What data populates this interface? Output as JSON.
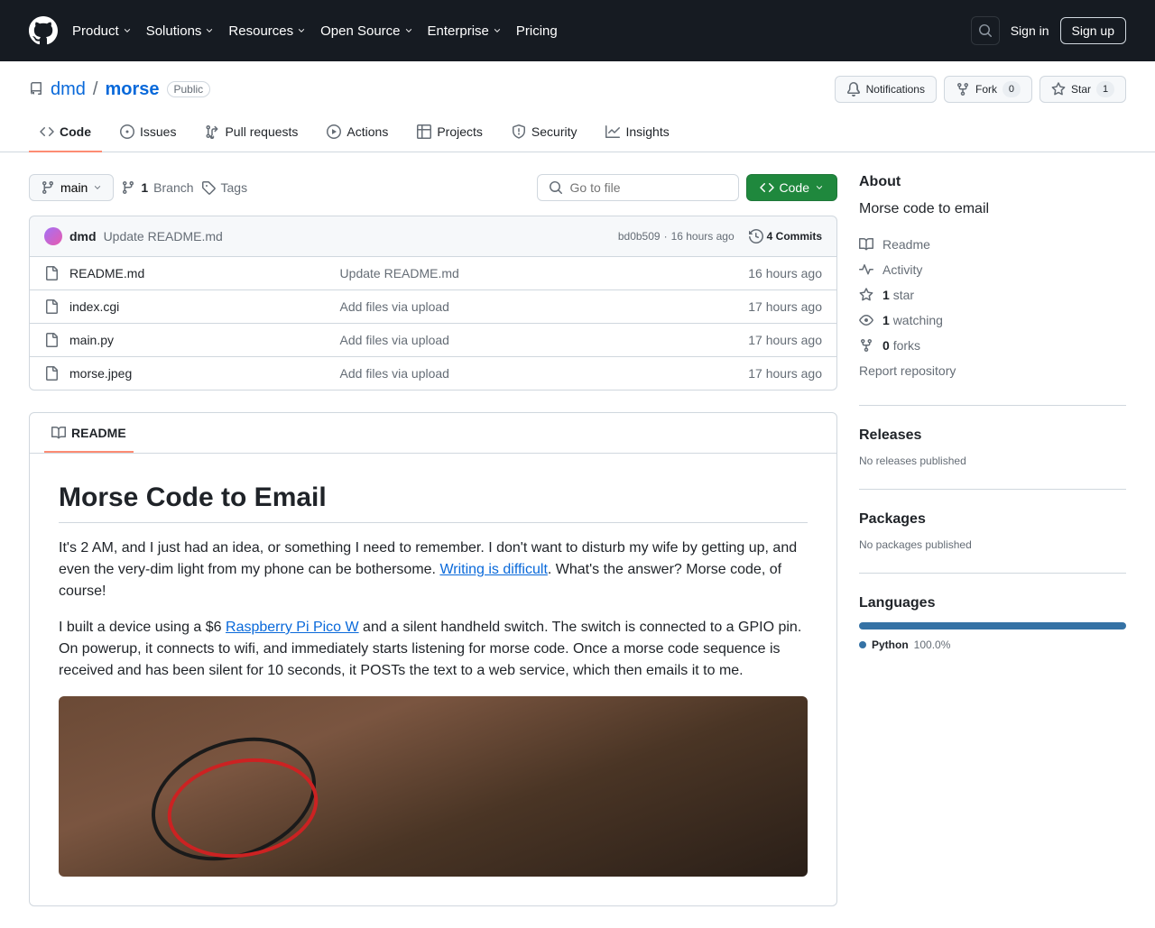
{
  "header": {
    "nav": [
      "Product",
      "Solutions",
      "Resources",
      "Open Source",
      "Enterprise",
      "Pricing"
    ],
    "signin": "Sign in",
    "signup": "Sign up"
  },
  "repo": {
    "owner": "dmd",
    "name": "morse",
    "visibility": "Public",
    "actions": {
      "notifications": "Notifications",
      "fork": "Fork",
      "fork_count": "0",
      "star": "Star",
      "star_count": "1"
    }
  },
  "tabs": [
    {
      "label": "Code",
      "icon": "code",
      "active": true
    },
    {
      "label": "Issues",
      "icon": "issues"
    },
    {
      "label": "Pull requests",
      "icon": "pr"
    },
    {
      "label": "Actions",
      "icon": "play"
    },
    {
      "label": "Projects",
      "icon": "table"
    },
    {
      "label": "Security",
      "icon": "shield"
    },
    {
      "label": "Insights",
      "icon": "graph"
    }
  ],
  "branch": {
    "name": "main",
    "branches_count": "1",
    "branches_label": "Branch",
    "tags_label": "Tags"
  },
  "gotofile_placeholder": "Go to file",
  "code_btn": "Code",
  "commit": {
    "author": "dmd",
    "message": "Update README.md",
    "sha": "bd0b509",
    "time": "16 hours ago",
    "count_label": "4 Commits"
  },
  "files": [
    {
      "name": "README.md",
      "msg": "Update README.md",
      "time": "16 hours ago"
    },
    {
      "name": "index.cgi",
      "msg": "Add files via upload",
      "time": "17 hours ago"
    },
    {
      "name": "main.py",
      "msg": "Add files via upload",
      "time": "17 hours ago"
    },
    {
      "name": "morse.jpeg",
      "msg": "Add files via upload",
      "time": "17 hours ago"
    }
  ],
  "readme": {
    "tab_label": "README",
    "title": "Morse Code to Email",
    "p1a": "It's 2 AM, and I just had an idea, or something I need to remember. I don't want to disturb my wife by getting up, and even the very-dim light from my phone can be bothersome. ",
    "p1_link": "Writing is difficult",
    "p1b": ". What's the answer? Morse code, of course!",
    "p2a": "I built a device using a $6 ",
    "p2_link": "Raspberry Pi Pico W",
    "p2b": " and a silent handheld switch. The switch is connected to a GPIO pin. On powerup, it connects to wifi, and immediately starts listening for morse code. Once a morse code sequence is received and has been silent for 10 seconds, it POSTs the text to a web service, which then emails it to me."
  },
  "sidebar": {
    "about_heading": "About",
    "about_desc": "Morse code to email",
    "readme_link": "Readme",
    "activity_link": "Activity",
    "stars_count": "1",
    "stars_label": "star",
    "watching_count": "1",
    "watching_label": "watching",
    "forks_count": "0",
    "forks_label": "forks",
    "report_link": "Report repository",
    "releases_heading": "Releases",
    "releases_empty": "No releases published",
    "packages_heading": "Packages",
    "packages_empty": "No packages published",
    "languages_heading": "Languages",
    "lang_name": "Python",
    "lang_pct": "100.0%"
  }
}
